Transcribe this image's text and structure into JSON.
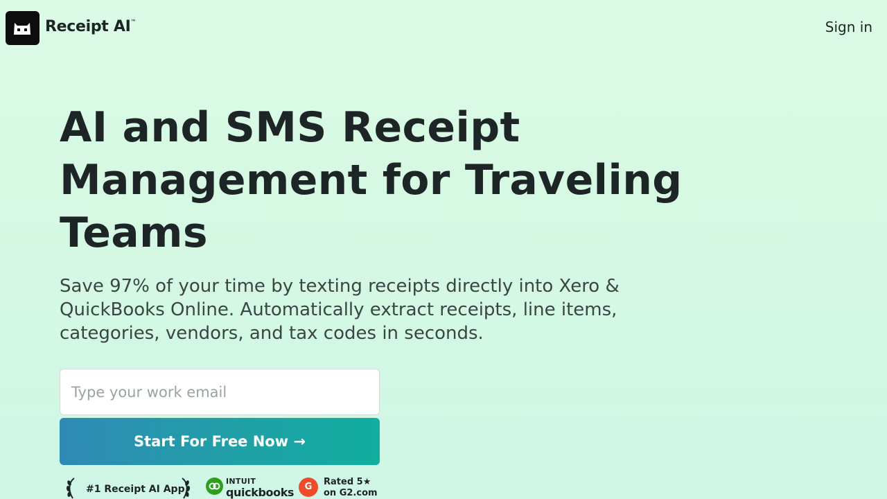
{
  "header": {
    "brand": "Receipt AI",
    "brand_tm": "™",
    "logo_icon": "cat-face-icon",
    "sign_in": "Sign in"
  },
  "hero": {
    "title": "AI and SMS Receipt Management for Traveling Teams",
    "subtitle": "Save 97% of your time by texting receipts directly into Xero & QuickBooks Online. Automatically extract receipts, line items, categories, vendors, and tax codes in seconds.",
    "email_placeholder": "Type your work email",
    "email_value": "",
    "cta_label": "Start For Free Now →"
  },
  "badges": {
    "award": "#1 Receipt AI App",
    "award_icon": "laurel-wreath-icon",
    "quickbooks_icon": "quickbooks-logo-icon",
    "quickbooks_top": "INTUIT",
    "quickbooks_bottom": "quickbooks",
    "g2_icon": "g2-logo-icon",
    "g2_letter": "G",
    "g2_line1": "Rated 5★",
    "g2_line2": "on G2.com"
  },
  "colors": {
    "background": "#d4f8e3",
    "text": "#1c2526",
    "cta_start": "#2f8ab5",
    "cta_end": "#12ae9f",
    "quickbooks_green": "#2ca01c",
    "g2_red": "#ef4c2c"
  }
}
